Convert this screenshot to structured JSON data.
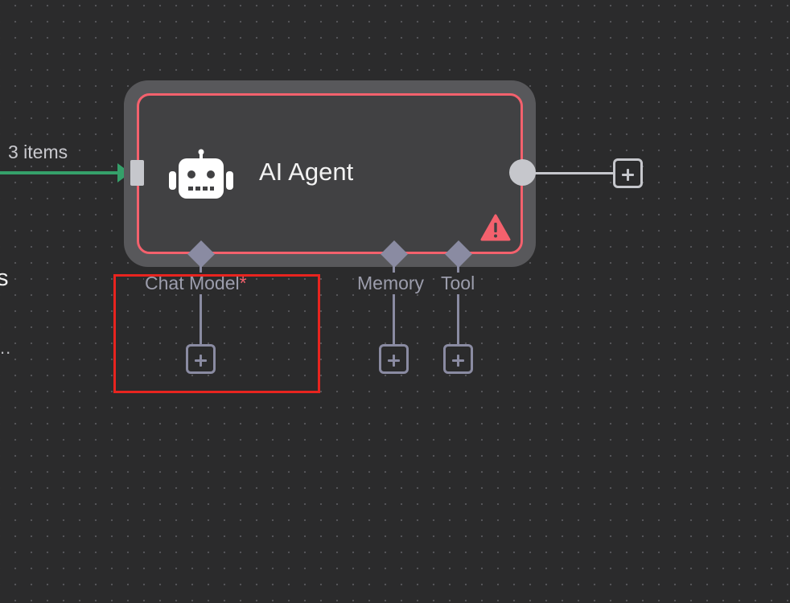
{
  "connection": {
    "items_label": "3 items"
  },
  "partial_left": {
    "text": "s",
    "ellipsis": ".."
  },
  "node": {
    "title": "AI Agent",
    "icon": "robot-icon",
    "warning_icon": "warning-triangle-icon",
    "border_color": "#f4616d"
  },
  "slots": [
    {
      "label": "Chat Model",
      "required_mark": "*"
    },
    {
      "label": "Memory"
    },
    {
      "label": "Tool"
    }
  ],
  "colors": {
    "canvas": "#2b2b2c",
    "connection": "#35a06a",
    "handle": "#c6c7cc",
    "slot": "#8a8ba2",
    "highlight": "#e8241f"
  }
}
